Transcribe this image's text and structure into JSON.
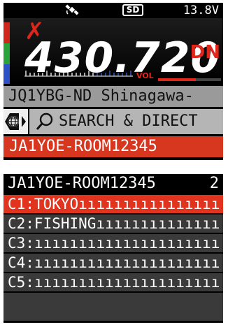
{
  "status": {
    "gps_icon": "satellite-icon",
    "sd_label": "SD",
    "voltage": "13.8V"
  },
  "vfo": {
    "frequency": "430.720",
    "mode": "DN",
    "vol_label": "VOL",
    "vol_level": 0.6,
    "colors": {
      "accent": "#e0251b",
      "green": "#29a33a",
      "blue": "#2d52c7"
    }
  },
  "info": {
    "callsign_row": "JQ1YBG-ND  Shinagawa-",
    "search_label": "SEARCH & DIRECT",
    "active_room": "JA1YOE-ROOM12345"
  },
  "list": {
    "title": "JA1YOE-ROOM12345",
    "count": "2",
    "items": [
      {
        "label": "C1:TOKYO",
        "selected": true
      },
      {
        "label": "C2:FISHING",
        "selected": false
      },
      {
        "label": "C3:",
        "selected": false
      },
      {
        "label": "C4:",
        "selected": false
      },
      {
        "label": "C5:",
        "selected": false
      }
    ],
    "padding_char": "ı"
  }
}
